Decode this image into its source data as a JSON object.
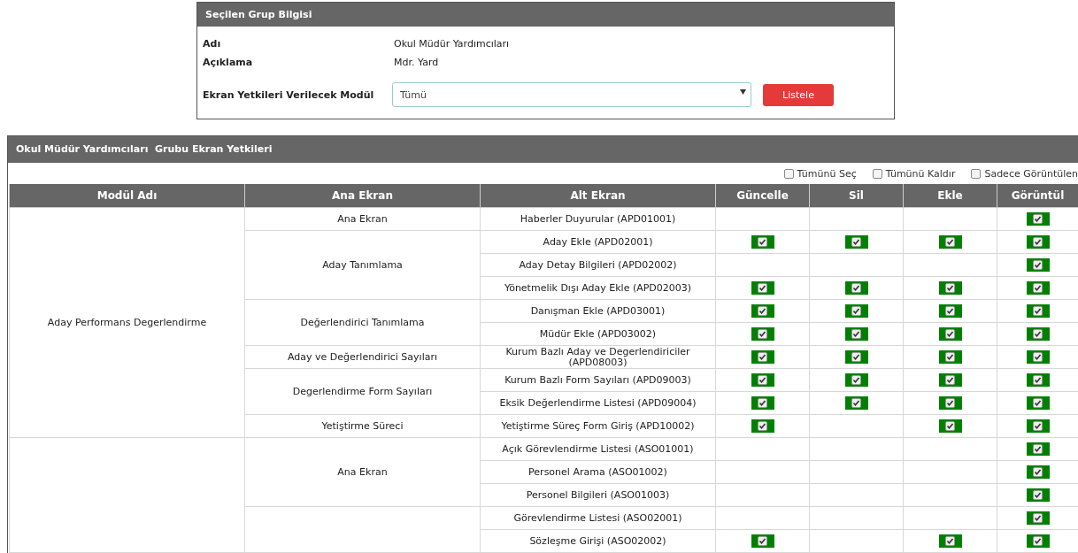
{
  "group_panel": {
    "title": "Seçilen Grup Bilgisi",
    "fields": [
      {
        "label": "Adı",
        "value": "Okul Müdür Yardımcıları"
      },
      {
        "label": "Açıklama",
        "value": "Mdr. Yard"
      }
    ],
    "module_filter": {
      "label": "Ekran Yetkileri Verilecek Modül",
      "value": "Tümü"
    },
    "list_button": "Listele"
  },
  "permissions_panel": {
    "title": "Okul Müdür Yardımcıları  Grubu Ekran Yetkileri",
    "bulk_options": [
      {
        "label": "Tümünü Seç",
        "checked": false
      },
      {
        "label": "Tümünü Kaldır",
        "checked": false
      },
      {
        "label": "Sadece Görüntülen",
        "checked": false
      }
    ],
    "columns": [
      "Modül Adı",
      "Ana Ekran",
      "Alt Ekran",
      "Güncelle",
      "Sil",
      "Ekle",
      "Görüntül"
    ],
    "modules": [
      {
        "name": "Aday Performans Degerlendirme",
        "screens": [
          {
            "name": "Ana Ekran",
            "sub_screens": [
              {
                "name": "Haberler Duyurular (APD01001)",
                "update": false,
                "delete": false,
                "add": false,
                "view": true
              }
            ]
          },
          {
            "name": "Aday Tanımlama",
            "sub_screens": [
              {
                "name": "Aday Ekle (APD02001)",
                "update": true,
                "delete": true,
                "add": true,
                "view": true
              },
              {
                "name": "Aday Detay Bilgileri (APD02002)",
                "update": false,
                "delete": false,
                "add": false,
                "view": true
              },
              {
                "name": "Yönetmelik Dışı Aday Ekle (APD02003)",
                "update": true,
                "delete": true,
                "add": true,
                "view": true
              }
            ]
          },
          {
            "name": "Değerlendirici Tanımlama",
            "sub_screens": [
              {
                "name": "Danışman Ekle (APD03001)",
                "update": true,
                "delete": true,
                "add": true,
                "view": true
              },
              {
                "name": "Müdür Ekle (APD03002)",
                "update": true,
                "delete": true,
                "add": true,
                "view": true
              }
            ]
          },
          {
            "name": "Aday ve Değerlendirici Sayıları",
            "sub_screens": [
              {
                "name": "Kurum Bazlı Aday ve Degerlendiriciler (APD08003)",
                "update": true,
                "delete": true,
                "add": true,
                "view": true
              }
            ]
          },
          {
            "name": "Degerlendirme Form Sayıları",
            "sub_screens": [
              {
                "name": "Kurum Bazlı Form Sayıları (APD09003)",
                "update": true,
                "delete": true,
                "add": true,
                "view": true
              },
              {
                "name": "Eksik Değerlendirme Listesi (APD09004)",
                "update": true,
                "delete": true,
                "add": true,
                "view": true
              }
            ]
          },
          {
            "name": "Yetiştirme Süreci",
            "sub_screens": [
              {
                "name": "Yetiştirme Süreç Form Giriş (APD10002)",
                "update": true,
                "delete": false,
                "add": true,
                "view": true
              }
            ]
          }
        ]
      },
      {
        "screens": [
          {
            "name": "Ana Ekran",
            "sub_screens": [
              {
                "name": "Açık Görevlendirme Listesi (ASO01001)",
                "update": false,
                "delete": false,
                "add": false,
                "view": true
              },
              {
                "name": "Personel Arama (ASO01002)",
                "update": false,
                "delete": false,
                "add": false,
                "view": true
              },
              {
                "name": "Personel Bilgileri (ASO01003)",
                "update": false,
                "delete": false,
                "add": false,
                "view": true
              }
            ]
          },
          {
            "sub_screens": [
              {
                "name": "Görevlendirme Listesi (ASO02001)",
                "update": false,
                "delete": false,
                "add": false,
                "view": true
              },
              {
                "name": "Sözleşme Girişi (ASO02002)",
                "update": true,
                "delete": false,
                "add": true,
                "view": true
              }
            ]
          }
        ]
      }
    ]
  }
}
